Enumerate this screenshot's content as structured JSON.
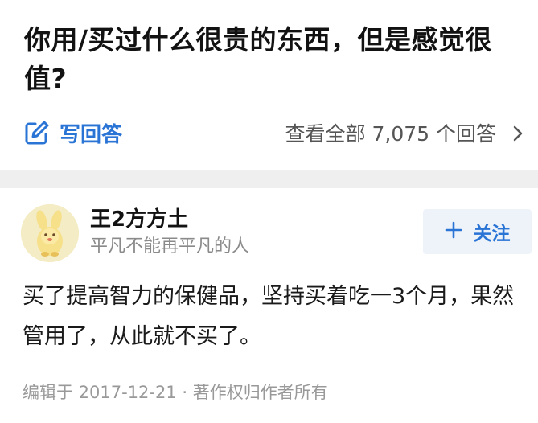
{
  "question": {
    "title": "你用/买过什么很贵的东西，但是感觉很值?",
    "write_answer_label": "写回答",
    "view_all_label": "查看全部 7,075 个回答"
  },
  "answer": {
    "author_name": "王2方方土",
    "author_bio": "平凡不能再平凡的人",
    "follow_label": "关注",
    "content": "买了提高智力的保健品，坚持买着吃一3个月，果然管用了，从此就不买了。",
    "meta": "编辑于 2017-12-21 · 著作权归作者所有"
  },
  "icons": {
    "write": "edit-icon",
    "chevron": "chevron-right-icon",
    "plus": "plus-icon"
  },
  "colors": {
    "accent": "#2a74d6",
    "band": "#efefef",
    "follow_bg": "#eef3fa"
  }
}
